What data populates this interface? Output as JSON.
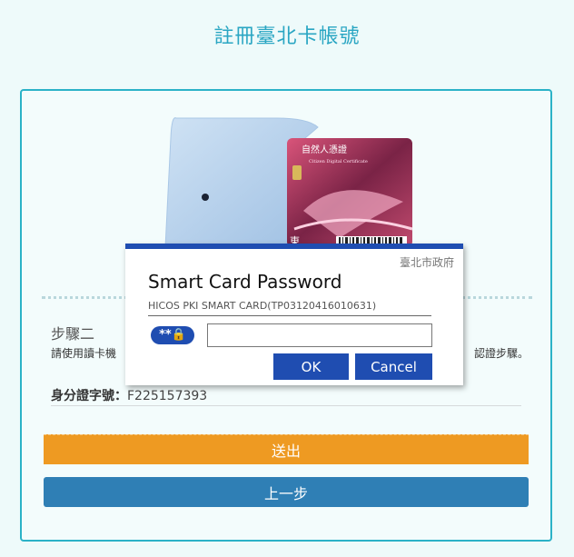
{
  "page": {
    "title": "註冊臺北卡帳號"
  },
  "illustration": {
    "card_title": "自然人憑證",
    "card_subtitle": "Citizen Digital Certificate",
    "card_edge_text": "東"
  },
  "step": {
    "title": "步驟二",
    "description_start": "請使用讀卡機",
    "description_end": "認證步驟。"
  },
  "id_field": {
    "label": "身分證字號：",
    "value": "F225157393"
  },
  "buttons": {
    "submit": "送出",
    "previous": "上一步"
  },
  "dialog": {
    "org": "臺北市政府",
    "title": "Smart Card Password",
    "subtitle": "HICOS PKI SMART CARD(TP03120416010631)",
    "pin_badge": "**🔒",
    "pin_value": "",
    "ok": "OK",
    "cancel": "Cancel"
  }
}
